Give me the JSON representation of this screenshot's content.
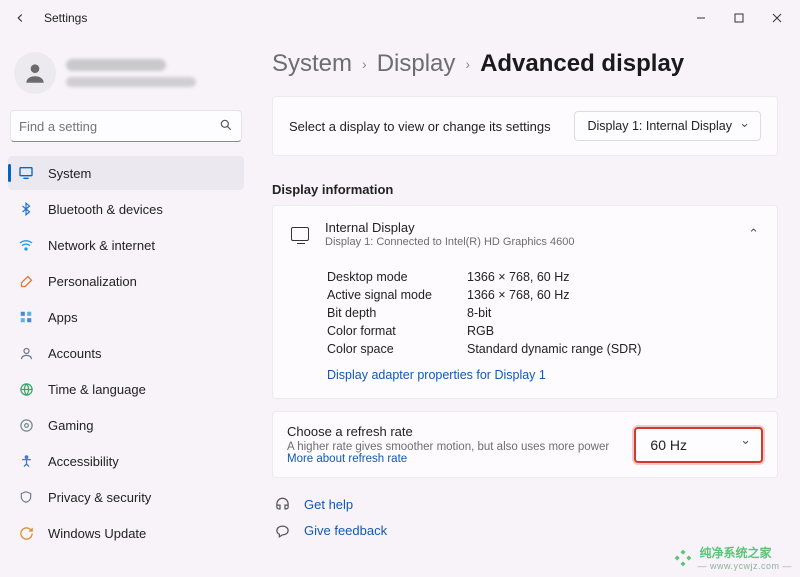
{
  "titlebar": {
    "title": "Settings"
  },
  "profile": {
    "name_redacted": true,
    "email_redacted": true
  },
  "search": {
    "placeholder": "Find a setting"
  },
  "nav": {
    "items": [
      {
        "label": "System"
      },
      {
        "label": "Bluetooth & devices"
      },
      {
        "label": "Network & internet"
      },
      {
        "label": "Personalization"
      },
      {
        "label": "Apps"
      },
      {
        "label": "Accounts"
      },
      {
        "label": "Time & language"
      },
      {
        "label": "Gaming"
      },
      {
        "label": "Accessibility"
      },
      {
        "label": "Privacy & security"
      },
      {
        "label": "Windows Update"
      }
    ],
    "selected": 0
  },
  "breadcrumb": {
    "lvl1": "System",
    "lvl2": "Display",
    "lvl3": "Advanced display"
  },
  "select_display": {
    "label": "Select a display to view or change its settings",
    "value": "Display 1: Internal Display"
  },
  "info_section_title": "Display information",
  "info_header": {
    "title": "Internal Display",
    "subtitle": "Display 1: Connected to Intel(R) HD Graphics 4600"
  },
  "info_rows": [
    {
      "k": "Desktop mode",
      "v": "1366 × 768, 60 Hz"
    },
    {
      "k": "Active signal mode",
      "v": "1366 × 768, 60 Hz"
    },
    {
      "k": "Bit depth",
      "v": "8-bit"
    },
    {
      "k": "Color format",
      "v": "RGB"
    },
    {
      "k": "Color space",
      "v": "Standard dynamic range (SDR)"
    }
  ],
  "adapter_link": "Display adapter properties for Display 1",
  "refresh": {
    "title": "Choose a refresh rate",
    "desc": "A higher rate gives smoother motion, but also uses more power ",
    "more_link": "More about refresh rate",
    "value": "60 Hz"
  },
  "help": {
    "get": "Get help",
    "feedback": "Give feedback"
  },
  "watermark": {
    "main": "纯净系统之家",
    "sub": "— www.ycwjz.com —"
  }
}
